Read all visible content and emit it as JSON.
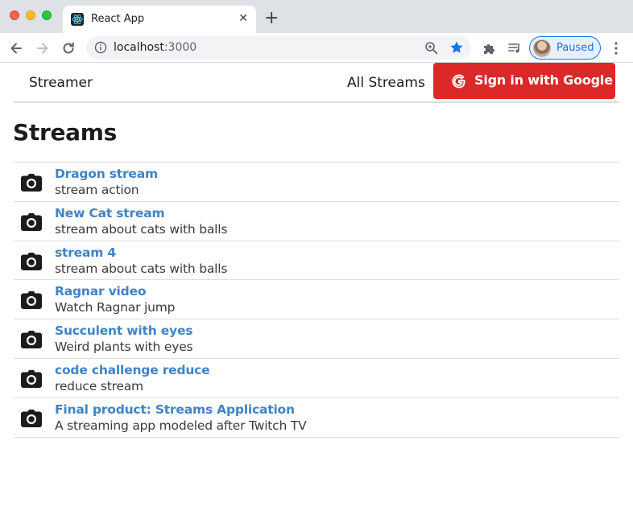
{
  "browser": {
    "tab": {
      "title": "React App",
      "close_label": "✕",
      "favicon": "react-logo-icon"
    },
    "new_tab_label": "+",
    "url_host": "localhost",
    "url_port": ":3000",
    "profile_label": "Paused",
    "accent_color": "#1a73e8"
  },
  "app": {
    "brand": "Streamer",
    "nav_all_streams": "All Streams",
    "auth_button_label": "Sign in with Google",
    "auth_button_color": "#db2828",
    "page_title": "Streams"
  },
  "streams": [
    {
      "title": "Dragon stream",
      "description": "stream action",
      "icon": "camera-icon"
    },
    {
      "title": "New Cat stream",
      "description": "stream about cats with balls",
      "icon": "camera-icon"
    },
    {
      "title": "stream 4",
      "description": "stream about cats with balls",
      "icon": "camera-icon"
    },
    {
      "title": "Ragnar video",
      "description": "Watch Ragnar jump",
      "icon": "camera-icon"
    },
    {
      "title": "Succulent with eyes",
      "description": "Weird plants with eyes",
      "icon": "camera-icon"
    },
    {
      "title": "code challenge reduce",
      "description": "reduce stream",
      "icon": "camera-icon"
    },
    {
      "title": "Final product: Streams Application",
      "description": "A streaming app modeled after Twitch TV",
      "icon": "camera-icon"
    }
  ]
}
